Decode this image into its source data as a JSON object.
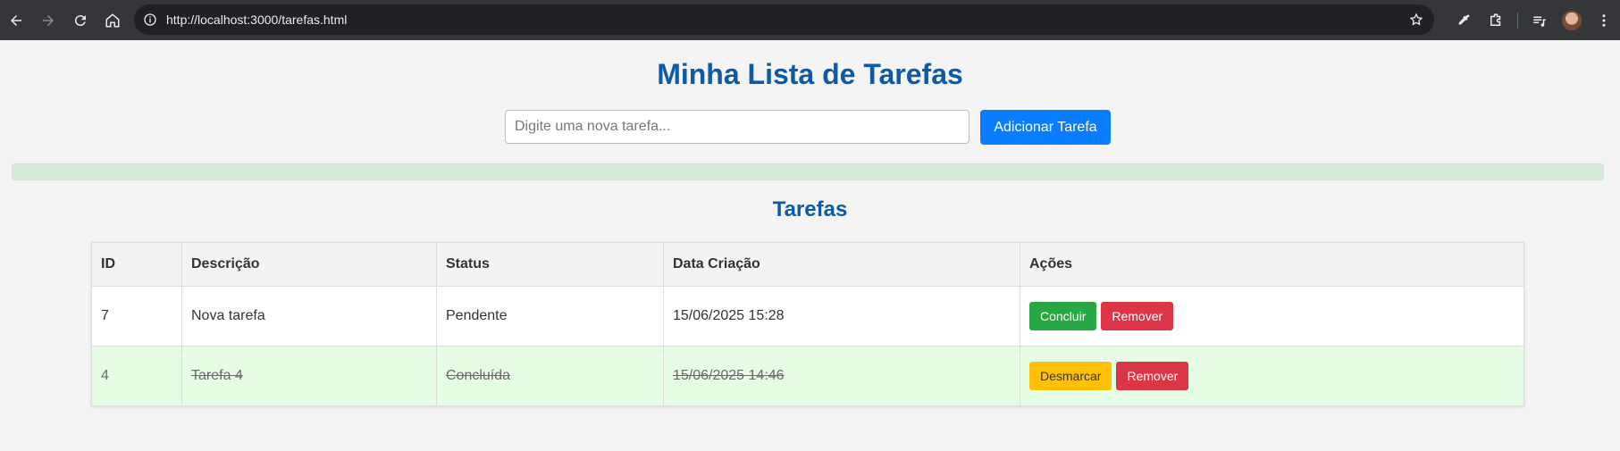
{
  "browser": {
    "url": "http://localhost:3000/tarefas.html"
  },
  "page": {
    "title": "Minha Lista de Tarefas",
    "input_placeholder": "Digite uma nova tarefa...",
    "add_button": "Adicionar Tarefa",
    "section_title": "Tarefas"
  },
  "table": {
    "headers": [
      "ID",
      "Descrição",
      "Status",
      "Data Criação",
      "Ações"
    ],
    "rows": [
      {
        "id": "7",
        "descricao": "Nova tarefa",
        "status": "Pendente",
        "data": "15/06/2025 15:28",
        "action1": "Concluir",
        "action2": "Remover"
      },
      {
        "id": "4",
        "descricao": "Tarefa 4",
        "status": "Concluída",
        "data": "15/06/2025 14:46",
        "action1": "Desmarcar",
        "action2": "Remover"
      }
    ]
  },
  "colors": {
    "title": "#0d5aa7",
    "primary": "#0a7cff",
    "success": "#28a745",
    "danger": "#dc3545",
    "warning": "#ffc107",
    "completed_row": "#e4fde4"
  }
}
